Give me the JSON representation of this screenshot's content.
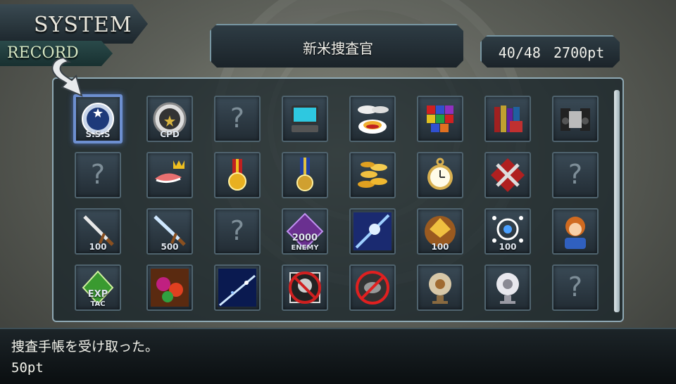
{
  "header": {
    "system_tab": "SYSTEM",
    "record_tab": "RECORD",
    "selected_title": "新米捜査官",
    "progress": "40/48",
    "points": "2700pt"
  },
  "grid": {
    "rows": [
      [
        {
          "icon": "sss-badge-icon",
          "label": "S.S.S"
        },
        {
          "icon": "cpd-badge-icon",
          "label": "CPD"
        },
        {
          "icon": "locked-question-icon",
          "label": "?"
        },
        {
          "icon": "computer-terminal-icon",
          "label": ""
        },
        {
          "icon": "food-plates-icon",
          "label": ""
        },
        {
          "icon": "colored-blocks-icon",
          "label": ""
        },
        {
          "icon": "books-icon",
          "label": ""
        },
        {
          "icon": "stereo-icon",
          "label": ""
        }
      ],
      [
        {
          "icon": "locked-question-icon",
          "label": "?"
        },
        {
          "icon": "king-fish-icon",
          "label": ""
        },
        {
          "icon": "gold-medal-icon",
          "label": ""
        },
        {
          "icon": "badge-medal-icon",
          "label": ""
        },
        {
          "icon": "gold-coins-icon",
          "label": ""
        },
        {
          "icon": "pocket-watch-icon",
          "label": ""
        },
        {
          "icon": "tools-crossed-icon",
          "label": ""
        },
        {
          "icon": "locked-question-icon",
          "label": "?"
        }
      ],
      [
        {
          "icon": "sword-100-icon",
          "label": "100"
        },
        {
          "icon": "sword-500-icon",
          "label": "500"
        },
        {
          "icon": "locked-question-icon",
          "label": "?"
        },
        {
          "icon": "enemy-2000-icon",
          "label": "2000",
          "sublabel": "ENEMY"
        },
        {
          "icon": "light-slash-icon",
          "label": ""
        },
        {
          "icon": "gem-100-icon",
          "label": "100"
        },
        {
          "icon": "network-100-icon",
          "label": "100"
        },
        {
          "icon": "character-portrait-icon",
          "label": ""
        }
      ],
      [
        {
          "icon": "exp-tac-icon",
          "label": "EXP",
          "sublabel": "TAC"
        },
        {
          "icon": "flower-burst-icon",
          "label": ""
        },
        {
          "icon": "blue-streak-icon",
          "label": ""
        },
        {
          "icon": "no-skull-icon",
          "label": ""
        },
        {
          "icon": "no-symbol-icon",
          "label": ""
        },
        {
          "icon": "bronze-orb-icon",
          "label": ""
        },
        {
          "icon": "silver-orb-icon",
          "label": ""
        },
        {
          "icon": "locked-question-icon",
          "label": "?"
        }
      ]
    ],
    "selected": [
      0,
      0
    ]
  },
  "message": {
    "line1": "捜査手帳を受け取った。",
    "line2": "50pt"
  },
  "colors": {
    "panel_border": "#8fa9b4",
    "selection": "#6d8fd0"
  }
}
